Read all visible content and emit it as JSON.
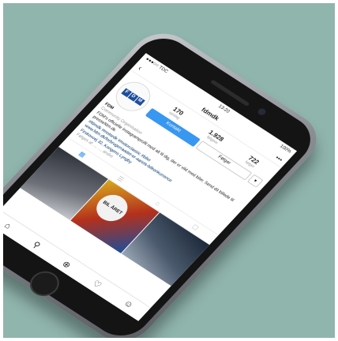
{
  "status": {
    "carrier": "●●●○○ TDC",
    "time": "13:20",
    "battery": "100%"
  },
  "header": {
    "username": "fdmdk",
    "back": "‹",
    "more": "•••"
  },
  "avatar": {
    "letters": [
      "F",
      "D",
      "M"
    ]
  },
  "stats": [
    {
      "num": "170",
      "label": "opslag"
    },
    {
      "num": "1.928",
      "label": "følgere"
    },
    {
      "num": "722",
      "label": "følger"
    }
  ],
  "actions": {
    "kontakt": "Kontakt",
    "folger": "Følger",
    "more": "▾"
  },
  "bio": {
    "name": "FDM",
    "category": "Community Organisation",
    "line1": "FDM's officielle instagramprofil med alt til dig, der er vild med biler. Send dit billede til",
    "line2": "pressefdm.dk",
    "hashtags": "#fdmdk #motordk #motorclassic #biler",
    "link": "www.fdm.dk/forbrugerraadet-er-aarets-bilkonkurrence",
    "address": "Firskovvej 32, Kongens Lyngby",
    "followed": "Følges af ..., ..., andre"
  },
  "tabs": [
    "▦",
    "☰",
    "⌂",
    "☐"
  ],
  "grid": {
    "badge": "BIL ÅRET"
  },
  "nav": [
    "⌂",
    "⚲",
    "⊕",
    "♡",
    "☺"
  ],
  "colors": {
    "accent": "#3897f0",
    "background": "#90b5ad"
  }
}
